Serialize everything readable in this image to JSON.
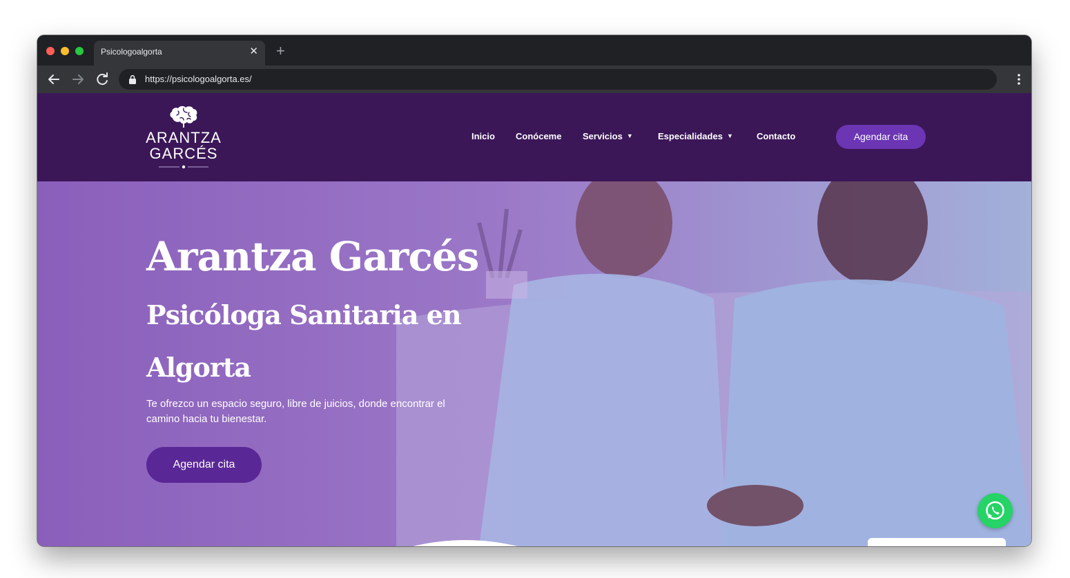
{
  "browser": {
    "tab_title": "Psicologoalgorta",
    "tab_close": "✕",
    "new_tab": "+",
    "url": "https://psicologoalgorta.es/"
  },
  "site": {
    "logo": {
      "line1": "ARANTZA",
      "line2": "GARCÉS"
    },
    "nav": {
      "inicio": "Inicio",
      "conoceme": "Conóceme",
      "servicios": "Servicios",
      "especialidades": "Especialidades",
      "contacto": "Contacto"
    },
    "header_cta": "Agendar cita"
  },
  "hero": {
    "title": "Arantza Garcés",
    "subtitle": "Psicóloga Sanitaria en Algorta",
    "description": "Te ofrezco un espacio seguro, libre de juicios, donde encontrar el camino hacia tu bienestar.",
    "cta": "Agendar cita"
  },
  "colors": {
    "header_bg": "#3b1758",
    "accent": "#6b35b3",
    "hero_button": "#5a2796",
    "whatsapp": "#25d366"
  },
  "icons": [
    "back-arrow-icon",
    "forward-arrow-icon",
    "reload-icon",
    "lock-icon",
    "kebab-menu-icon",
    "brain-icon",
    "chevron-down-icon",
    "whatsapp-icon"
  ]
}
